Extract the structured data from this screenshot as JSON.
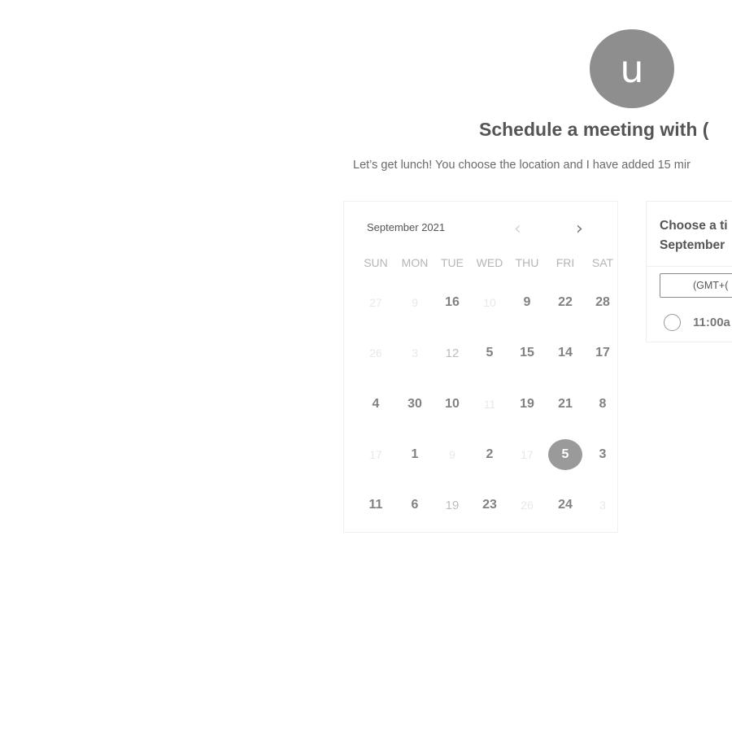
{
  "avatar": {
    "initial": "u"
  },
  "heading": "Schedule a meeting with (",
  "description": "Let’s get lunch! You choose the location and I have added 15 mir",
  "calendar": {
    "month_label": "September 2021",
    "prev_icon": "chevron-left-icon",
    "next_icon": "chevron-right-icon",
    "weekdays": [
      "SUN",
      "MON",
      "TUE",
      "WED",
      "THU",
      "FRI",
      "SAT"
    ],
    "weeks": [
      [
        {
          "day": "27",
          "state": "faint"
        },
        {
          "day": "9",
          "state": "faint"
        },
        {
          "day": "16",
          "state": "available"
        },
        {
          "day": "10",
          "state": "faint"
        },
        {
          "day": "9",
          "state": "available"
        },
        {
          "day": "22",
          "state": "available"
        },
        {
          "day": "28",
          "state": "available"
        }
      ],
      [
        {
          "day": "26",
          "state": "faint"
        },
        {
          "day": "3",
          "state": "faint"
        },
        {
          "day": "12",
          "state": "dim"
        },
        {
          "day": "5",
          "state": "available"
        },
        {
          "day": "15",
          "state": "available"
        },
        {
          "day": "14",
          "state": "available"
        },
        {
          "day": "17",
          "state": "available"
        }
      ],
      [
        {
          "day": "4",
          "state": "available"
        },
        {
          "day": "30",
          "state": "available"
        },
        {
          "day": "10",
          "state": "available"
        },
        {
          "day": "11",
          "state": "faint"
        },
        {
          "day": "19",
          "state": "available"
        },
        {
          "day": "21",
          "state": "available"
        },
        {
          "day": "8",
          "state": "available"
        }
      ],
      [
        {
          "day": "17",
          "state": "faint"
        },
        {
          "day": "1",
          "state": "available"
        },
        {
          "day": "9",
          "state": "faint"
        },
        {
          "day": "2",
          "state": "available"
        },
        {
          "day": "17",
          "state": "faint"
        },
        {
          "day": "5",
          "state": "selected"
        },
        {
          "day": "3",
          "state": "available"
        }
      ],
      [
        {
          "day": "11",
          "state": "available"
        },
        {
          "day": "6",
          "state": "available"
        },
        {
          "day": "19",
          "state": "dim"
        },
        {
          "day": "23",
          "state": "available"
        },
        {
          "day": "26",
          "state": "faint"
        },
        {
          "day": "24",
          "state": "available"
        },
        {
          "day": "3",
          "state": "faint"
        }
      ]
    ]
  },
  "side_panel": {
    "title_line1": "Choose a ti",
    "title_line2": "September",
    "timezone_label": "(GMT+(",
    "slot_label": "11:00a"
  },
  "colors": {
    "selected_day_bg": "#9a9a9a",
    "avatar_bg": "#8e8e8e"
  }
}
